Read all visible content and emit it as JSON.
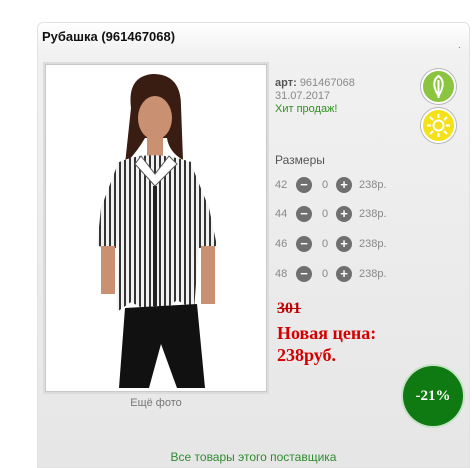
{
  "product": {
    "title": "Рубашка (961467068)",
    "title_dot": ".",
    "more_photo": "Ещё фото",
    "article_label": "арт:",
    "article": "961467068",
    "date": "31.07.2017",
    "hit": "Хит продаж!"
  },
  "badges": {
    "eco_icon": "leaf-icon",
    "season_icon": "sun-icon",
    "eco_color": "#8bc43f",
    "season_color": "#f4e11a"
  },
  "sizes": {
    "title": "Размеры",
    "rows": [
      {
        "size": "42",
        "qty": "0",
        "price": "238р."
      },
      {
        "size": "44",
        "qty": "0",
        "price": "238р."
      },
      {
        "size": "46",
        "qty": "0",
        "price": "238р."
      },
      {
        "size": "48",
        "qty": "0",
        "price": "238р."
      }
    ],
    "minus": "−",
    "plus": "+"
  },
  "pricing": {
    "old_price": "301",
    "new_price_label": "Новая цена:",
    "new_price": "238руб.",
    "discount": "-21%",
    "price_color": "#d40000",
    "discount_color": "#0f7a12"
  },
  "footer": {
    "supplier_link": "Все товары этого поставщика"
  }
}
